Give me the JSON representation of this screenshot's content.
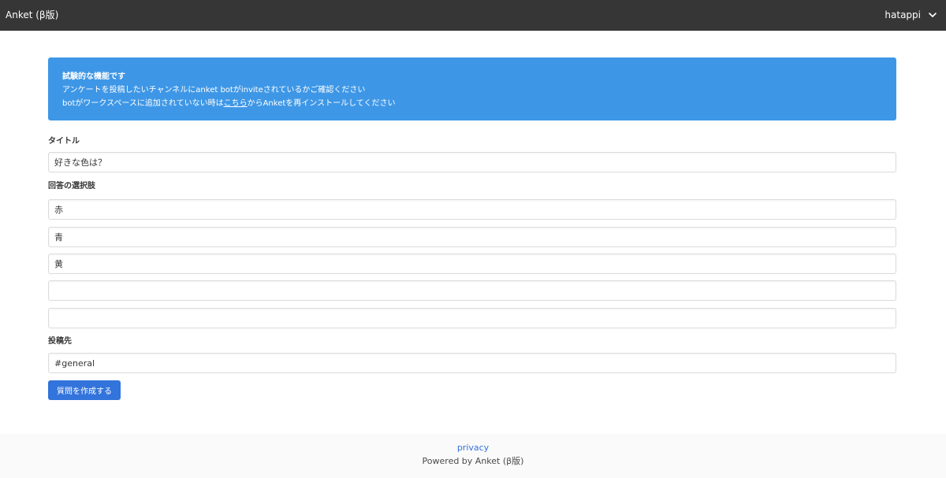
{
  "navbar": {
    "brand": "Anket (β版)",
    "user": "hatappi",
    "menu_icon": "chevron-down-icon"
  },
  "notice": {
    "title": "試験的な機能です",
    "line1": "アンケートを投稿したいチャンネルにanket botがinviteされているかご確認ください",
    "line2_before": "botがワークスペースに追加されていない時は",
    "line2_link": "こちら",
    "line2_after": "からAnketを再インストールしてください",
    "color": "#3e97e6"
  },
  "form": {
    "title_label": "タイトル",
    "title_value": "好きな色は？",
    "choices_label": "回答の選択肢",
    "choices": [
      "赤",
      "青",
      "黄",
      "",
      ""
    ],
    "channel_label": "投稿先",
    "channel_value": "#general",
    "submit_label": "質問を作成する",
    "submit_color": "#3273dc"
  },
  "footer": {
    "privacy_link": "privacy",
    "powered_by": "Powered by Anket (β版)"
  }
}
